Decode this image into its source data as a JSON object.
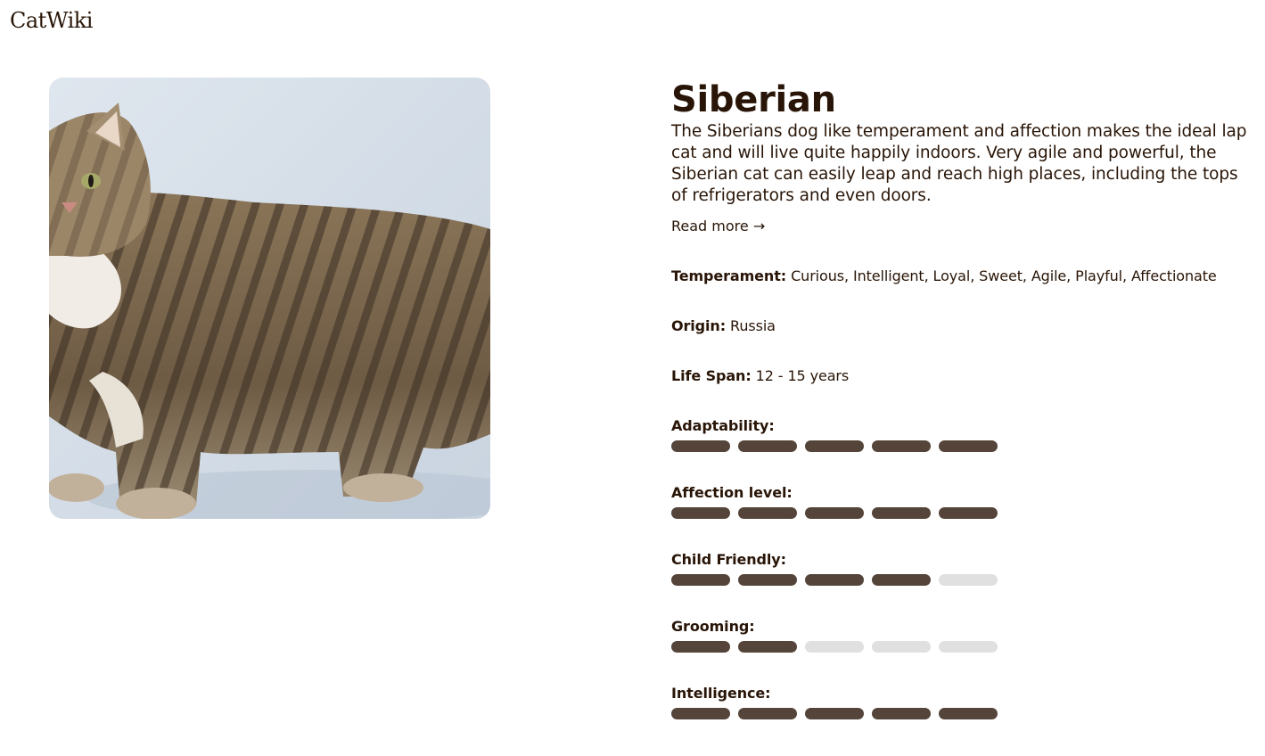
{
  "header": {
    "logo_text": "CatWiki"
  },
  "breed": {
    "name": "Siberian",
    "image_alt": "Siberian cat photo",
    "description": "The Siberians dog like temperament and affection makes the ideal lap cat and will live quite happily indoors. Very agile and powerful, the Siberian cat can easily leap and reach high places, including the tops of refrigerators and even doors.",
    "read_more": "Read more →",
    "facts": {
      "temperament_label": "Temperament:",
      "temperament_value": "Curious, Intelligent, Loyal, Sweet, Agile, Playful, Affectionate",
      "origin_label": "Origin:",
      "origin_value": "Russia",
      "life_span_label": "Life Span:",
      "life_span_value": "12 - 15 years"
    },
    "ratings": [
      {
        "label": "Adaptability:",
        "value": 5,
        "max": 5
      },
      {
        "label": "Affection level:",
        "value": 5,
        "max": 5
      },
      {
        "label": "Child Friendly:",
        "value": 4,
        "max": 5
      },
      {
        "label": "Grooming:",
        "value": 2,
        "max": 5
      },
      {
        "label": "Intelligence:",
        "value": 5,
        "max": 5
      }
    ]
  },
  "colors": {
    "text": "#291507",
    "bar_filled": "#544439",
    "bar_empty": "#e0e0e0"
  }
}
